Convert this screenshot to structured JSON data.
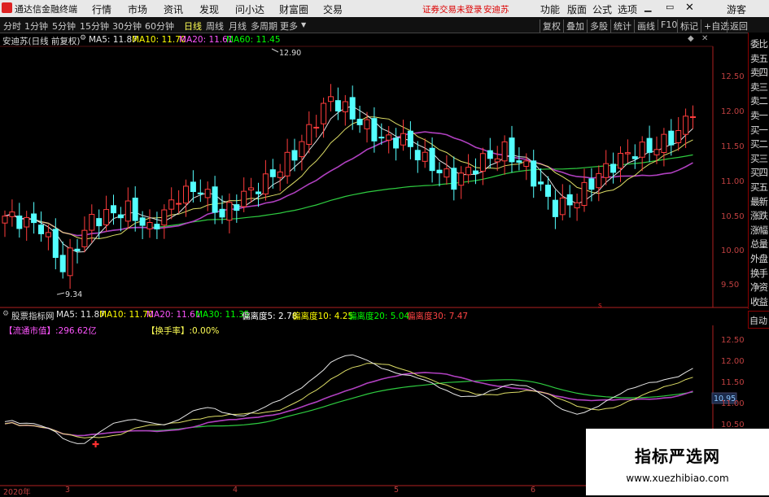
{
  "menubar": {
    "app_title": "通达信金融终端",
    "items": [
      "行情",
      "市场",
      "资讯",
      "发现",
      "问小达",
      "财富圈",
      "交易"
    ],
    "notice": "证券交易未登录",
    "stock": "安迪苏",
    "right_items": [
      "功能",
      "版面",
      "公式",
      "选项"
    ],
    "guest": "游客"
  },
  "toolbar": {
    "periods": [
      "分时",
      "1分钟",
      "5分钟",
      "15分钟",
      "30分钟",
      "60分钟",
      "日线",
      "周线",
      "月线",
      "多周期",
      "更多"
    ],
    "selected": "日线",
    "buttons": [
      "复权",
      "叠加",
      "多股",
      "统计",
      "画线",
      "F10",
      "标记",
      "+自选",
      "返回"
    ]
  },
  "main_info": {
    "title": "安迪苏(日线 前复权)",
    "ma5": "MA5: 11.87",
    "ma10": "MA10: 11.70",
    "ma20": "MA20: 11.61",
    "ma60": "MA60: 11.45"
  },
  "indicator_info": {
    "title": "股票指标网",
    "ma5": "MA5: 11.87",
    "ma10": "MA10: 11.70",
    "ma20": "MA20: 11.61",
    "ma30": "MA30: 11.35",
    "b5": "偏离度5: 2.78",
    "b10": "偏离度10: 4.25",
    "b20": "偏离度20: 5.04",
    "b30": "偏离度30: 7.47",
    "mktcap": "【流通市值】:296.62亿",
    "turnover": "【换手率】:0.00%"
  },
  "right_column": [
    "委比",
    "卖五",
    "卖四",
    "卖三",
    "卖二",
    "卖一",
    "买一",
    "买二",
    "买三",
    "买四",
    "买五",
    "最新",
    "涨跌",
    "涨幅",
    "总量",
    "外盘",
    "换手",
    "净资",
    "收益"
  ],
  "auto_label": "自动",
  "price_axis": [
    "12.50",
    "12.00",
    "11.50",
    "11.00",
    "10.50",
    "10.00",
    "9.50"
  ],
  "ind_axis": [
    "12.50",
    "12.00",
    "11.50",
    "11.00",
    "10.50"
  ],
  "ind_current": "10.95",
  "high_label": "12.90",
  "low_label": "9.34",
  "date_axis": [
    "2020年",
    "3",
    "4",
    "5",
    "6"
  ],
  "watermark": {
    "title": "指标严选网",
    "url": "www.xuezhibiao.com"
  },
  "colors": {
    "up": "#ff3c3c",
    "down": "#54ffff",
    "ma5": "#e6e6e6",
    "ma10": "#ffff00",
    "ma20": "#ff55ff",
    "ma60": "#00ff00"
  }
}
